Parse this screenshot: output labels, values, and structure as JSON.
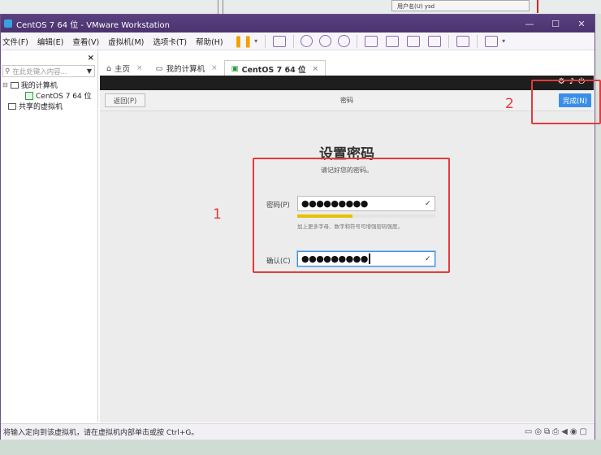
{
  "window": {
    "title": "CentOS 7 64 位 - VMware Workstation"
  },
  "background": {
    "popup_text": "用户名(U)   ysd"
  },
  "menu": [
    "文件(F)",
    "编辑(E)",
    "查看(V)",
    "虚拟机(M)",
    "选项卡(T)",
    "帮助(H)"
  ],
  "sidebar": {
    "close": "×",
    "search_placeholder": "在此处键入内容...",
    "tree": {
      "root": "我的计算机",
      "child": "CentOS 7 64 位",
      "shared": "共享的虚拟机"
    }
  },
  "tabs": [
    {
      "label": "主页"
    },
    {
      "label": "我的计算机"
    },
    {
      "label": "CentOS 7 64 位"
    }
  ],
  "installer": {
    "back_label": "返回(P)",
    "header_title": "密码",
    "done_label": "完成(N)",
    "page_title": "设置密码",
    "page_subtitle": "请记好您的密码。",
    "password_label": "密码(P)",
    "password_value": "●●●●●●●●●",
    "strength_fraction": 0.4,
    "strength_color": "#e6c200",
    "hint": "加上更多字母、数字和符号可增强密码强度。",
    "confirm_label": "确认(C)",
    "confirm_value": "●●●●●●●●●",
    "check": "✓"
  },
  "annotations": {
    "one": "1",
    "two": "2",
    "color": "#e53a3a"
  },
  "statusbar": {
    "text": "将输入定向到该虚拟机，请在虚拟机内部单击或按 Ctrl+G。"
  }
}
